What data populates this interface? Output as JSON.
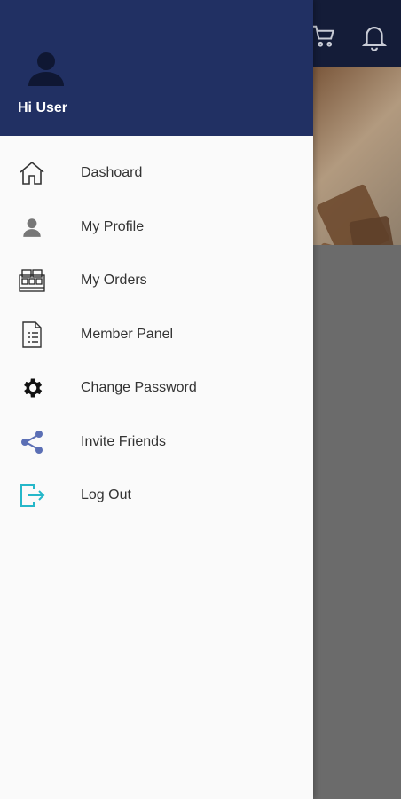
{
  "header": {
    "greeting": "Hi User"
  },
  "menu": {
    "items": [
      {
        "label": "Dashoard",
        "icon": "home-icon"
      },
      {
        "label": "My Profile",
        "icon": "person-icon"
      },
      {
        "label": "My Orders",
        "icon": "orders-icon"
      },
      {
        "label": "Member Panel",
        "icon": "document-icon"
      },
      {
        "label": "Change Password",
        "icon": "gear-icon"
      },
      {
        "label": "Invite Friends",
        "icon": "share-icon"
      },
      {
        "label": "Log Out",
        "icon": "logout-icon"
      }
    ]
  },
  "colors": {
    "drawer_header": "#213063",
    "app_topbar": "#141c38",
    "share_icon": "#5b6fb5",
    "logout_icon": "#25b7c9"
  }
}
